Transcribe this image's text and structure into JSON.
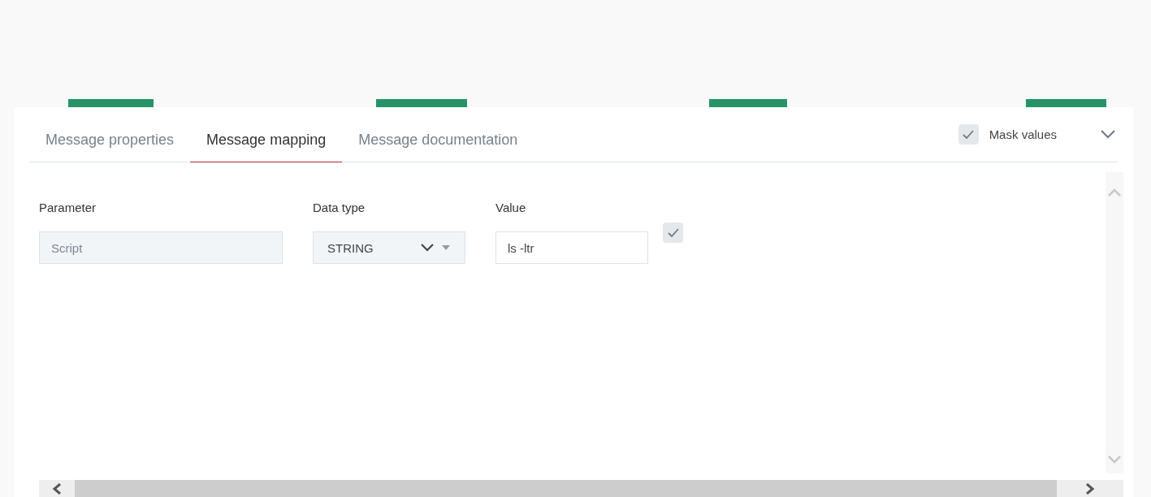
{
  "tabs": [
    {
      "label": "Message properties",
      "selected": false
    },
    {
      "label": "Message mapping",
      "selected": true
    },
    {
      "label": "Message documentation",
      "selected": false
    }
  ],
  "mask_values": {
    "label": "Mask values",
    "checked": true
  },
  "columns": [
    "Parameter",
    "Data type",
    "Value"
  ],
  "rows": [
    {
      "parameter": "Script",
      "parameter_disabled": true,
      "data_type": "STRING",
      "value": "ls -ltr",
      "checked": true
    }
  ]
}
